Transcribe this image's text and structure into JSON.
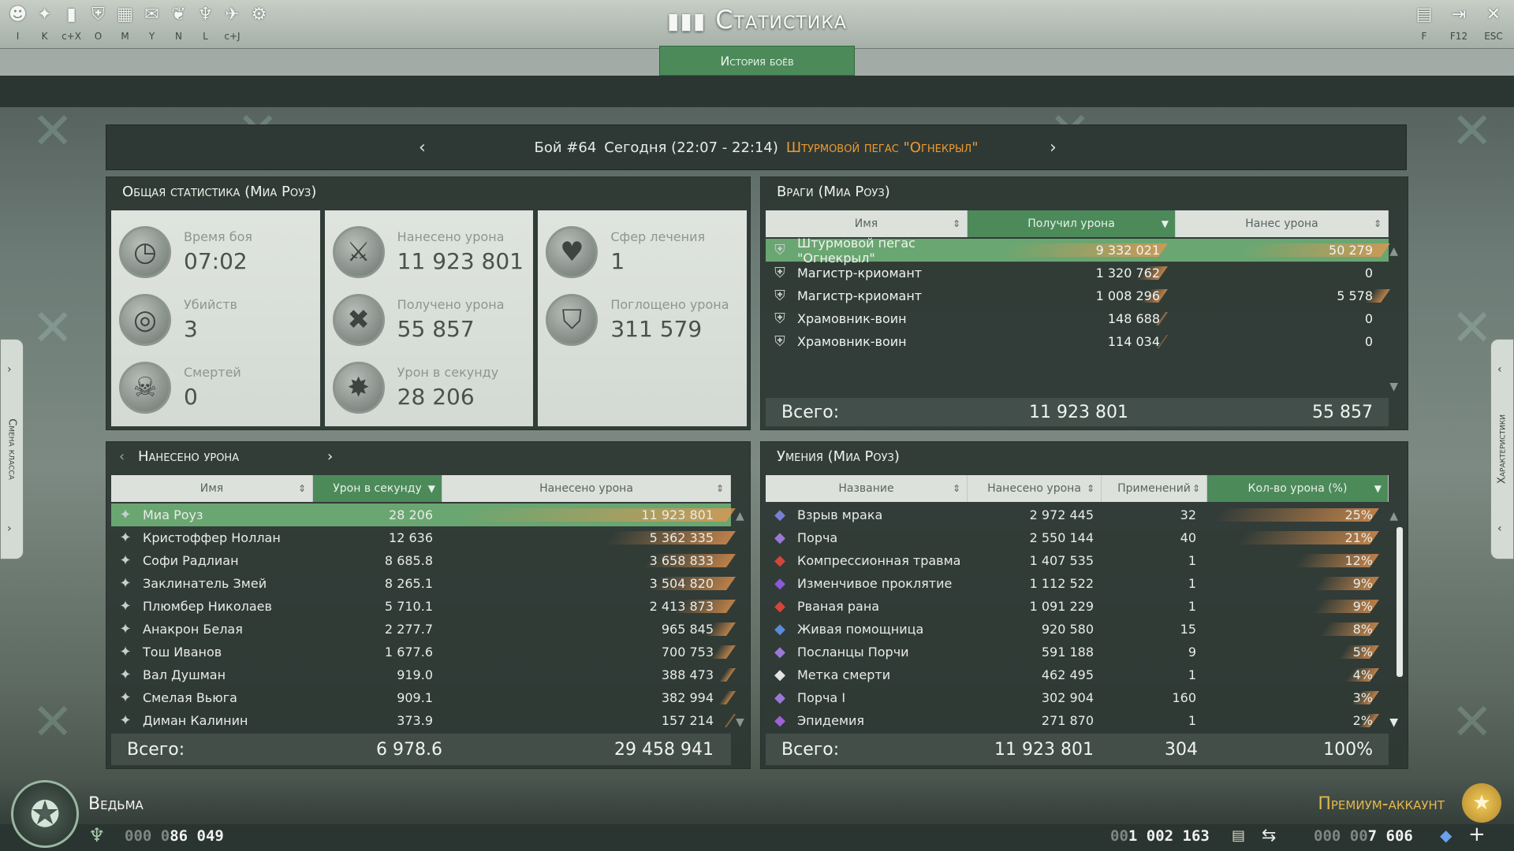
{
  "window": {
    "title": "Статистика",
    "tab_active": "История боёв"
  },
  "toolbar": {
    "left_icons": [
      {
        "icon": "character-alert-icon",
        "glyph": "☻",
        "key": "I"
      },
      {
        "icon": "skills-icon",
        "glyph": "✦",
        "key": "K"
      },
      {
        "icon": "statistics-icon",
        "glyph": "▮",
        "key": "c+X"
      },
      {
        "icon": "guild-icon",
        "glyph": "⛨",
        "key": "O"
      },
      {
        "icon": "map-icon",
        "glyph": "▦",
        "key": "M"
      },
      {
        "icon": "chat-icon",
        "glyph": "✉",
        "key": "Y"
      },
      {
        "icon": "mount-icon",
        "glyph": "❦",
        "key": "N"
      },
      {
        "icon": "faction-icon",
        "glyph": "♆",
        "key": "L"
      },
      {
        "icon": "pet-icon",
        "glyph": "✈",
        "key": "c+J"
      },
      {
        "icon": "settings-icon",
        "glyph": "⚙",
        "key": ""
      }
    ],
    "right_icons": [
      {
        "icon": "clipboard-icon",
        "glyph": "▤",
        "key": "F"
      },
      {
        "icon": "exit-icon",
        "glyph": "⇥",
        "key": "F12"
      },
      {
        "icon": "close-icon",
        "glyph": "✕",
        "key": "ESC"
      }
    ]
  },
  "battle": {
    "label": "Бой #64",
    "time": "Сегодня (22:07 - 22:14)",
    "boss": "Штурмовой пегас \"Огнекрыл\""
  },
  "general": {
    "title": "Общая статистика (Миа Роуз)",
    "stats": [
      {
        "label": "Время боя",
        "value": "07:02",
        "icon": "stopwatch-icon",
        "glyph": "◷"
      },
      {
        "label": "Убийств",
        "value": "3",
        "icon": "target-icon",
        "glyph": "◎"
      },
      {
        "label": "Смертей",
        "value": "0",
        "icon": "skull-icon",
        "glyph": "☠"
      },
      {
        "label": "Нанесено урона",
        "value": "11 923 801",
        "icon": "sword-icon",
        "glyph": "⚔"
      },
      {
        "label": "Получено урона",
        "value": "55 857",
        "icon": "cross-icon",
        "glyph": "✖"
      },
      {
        "label": "Урон в секунду",
        "value": "28 206",
        "icon": "burst-icon",
        "glyph": "✸"
      },
      {
        "label": "Сфер лечения",
        "value": "1",
        "icon": "heart-icon",
        "glyph": "♥"
      },
      {
        "label": "Поглощено урона",
        "value": "311 579",
        "icon": "shield-icon",
        "glyph": "⛉"
      }
    ]
  },
  "enemies": {
    "title": "Враги (Миа Роуз)",
    "headers": [
      "Имя",
      "Получил урона",
      "Нанес урона"
    ],
    "rows": [
      {
        "name": "Штурмовой пегас \"Огнекрыл\"",
        "received": "9 332 021",
        "dealt": "50 279",
        "received_frac": 1.0,
        "dealt_frac": 0.9
      },
      {
        "name": "Магистр-криомант",
        "received": "1 320 762",
        "dealt": "0",
        "received_frac": 0.14,
        "dealt_frac": 0.0
      },
      {
        "name": "Магистр-криомант",
        "received": "1 008 296",
        "dealt": "5 578",
        "received_frac": 0.11,
        "dealt_frac": 0.1
      },
      {
        "name": "Храмовник-воин",
        "received": "148 688",
        "dealt": "0",
        "received_frac": 0.02,
        "dealt_frac": 0.0
      },
      {
        "name": "Храмовник-воин",
        "received": "114 034",
        "dealt": "0",
        "received_frac": 0.01,
        "dealt_frac": 0.0
      }
    ],
    "total_label": "Всего:",
    "total_received": "11 923 801",
    "total_dealt": "55 857"
  },
  "dealt": {
    "title": "Нанесено урона",
    "headers": [
      "Имя",
      "Урон в секунду",
      "Нанесено урона"
    ],
    "rows": [
      {
        "name": "Миа Роуз",
        "dps": "28 206",
        "total": "11 923 801",
        "frac": 1.0
      },
      {
        "name": "Кристоффер Ноллан",
        "dps": "12 636",
        "total": "5 362 335",
        "frac": 0.45
      },
      {
        "name": "Софи Радлиан",
        "dps": "8 685.8",
        "total": "3 658 833",
        "frac": 0.31
      },
      {
        "name": "Заклинатель Змей",
        "dps": "8 265.1",
        "total": "3 504 820",
        "frac": 0.29
      },
      {
        "name": "Плюмбер Николаев",
        "dps": "5 710.1",
        "total": "2 413 873",
        "frac": 0.2
      },
      {
        "name": "Анакрон Белая",
        "dps": "2 277.7",
        "total": "965 845",
        "frac": 0.08
      },
      {
        "name": "Тош Иванов",
        "dps": "1 677.6",
        "total": "700 753",
        "frac": 0.06
      },
      {
        "name": "Вал Душман",
        "dps": "919.0",
        "total": "388 473",
        "frac": 0.03
      },
      {
        "name": "Смелая Вьюга",
        "dps": "909.1",
        "total": "382 994",
        "frac": 0.03
      },
      {
        "name": "Диман Калинин",
        "dps": "373.9",
        "total": "157 214",
        "frac": 0.01
      }
    ],
    "total_label": "Всего:",
    "total_dps": "6 978.6",
    "total_dealt": "29 458 941"
  },
  "skills": {
    "title": "Умения (Миа Роуз)",
    "headers": [
      "Название",
      "Нанесено урона",
      "Применений",
      "Кол-во урона (%)"
    ],
    "rows": [
      {
        "name": "Взрыв мрака",
        "damage": "2 972 445",
        "uses": "32",
        "pct": "25%",
        "frac": 1.0,
        "color": "#7a7ed8"
      },
      {
        "name": "Порча",
        "damage": "2 550 144",
        "uses": "40",
        "pct": "21%",
        "frac": 0.84,
        "color": "#9a78d6"
      },
      {
        "name": "Компрессионная травма",
        "damage": "1 407 535",
        "uses": "1",
        "pct": "12%",
        "frac": 0.48,
        "color": "#d8443a"
      },
      {
        "name": "Изменчивое проклятие",
        "damage": "1 112 522",
        "uses": "1",
        "pct": "9%",
        "frac": 0.36,
        "color": "#8a5ad8"
      },
      {
        "name": "Рваная рана",
        "damage": "1 091 229",
        "uses": "1",
        "pct": "9%",
        "frac": 0.36,
        "color": "#d8443a"
      },
      {
        "name": "Живая помощница",
        "damage": "920 580",
        "uses": "15",
        "pct": "8%",
        "frac": 0.32,
        "color": "#5a8ad8"
      },
      {
        "name": "Посланцы Порчи",
        "damage": "591 188",
        "uses": "9",
        "pct": "5%",
        "frac": 0.2,
        "color": "#9a78d6"
      },
      {
        "name": "Метка смерти",
        "damage": "462 495",
        "uses": "1",
        "pct": "4%",
        "frac": 0.16,
        "color": "#e4e4e4"
      },
      {
        "name": "Порча I",
        "damage": "302 904",
        "uses": "160",
        "pct": "3%",
        "frac": 0.12,
        "color": "#9a78d6"
      },
      {
        "name": "Эпидемия",
        "damage": "271 870",
        "uses": "1",
        "pct": "2%",
        "frac": 0.08,
        "color": "#a060d8"
      }
    ],
    "total_label": "Всего:",
    "total_damage": "11 923 801",
    "total_uses": "304",
    "total_pct": "100%"
  },
  "side_tabs": {
    "left": "Смена класса",
    "right": "Характеристики"
  },
  "footer": {
    "class_name": "Ведьма",
    "xp_zeros": "000 0",
    "xp_value": "86 049",
    "gold_zeros": "00",
    "gold_value": "1 002 163",
    "crystals_zeros": "000 00",
    "crystals_value": "7 606",
    "premium": "Премиум-аккаунт"
  },
  "colors": {
    "accent_green": "#4c8a5a",
    "selected_row": "#6aa671",
    "boss_orange": "#f09a2c",
    "premium_gold": "#e3b94b",
    "bar_orange": "#e89650"
  }
}
